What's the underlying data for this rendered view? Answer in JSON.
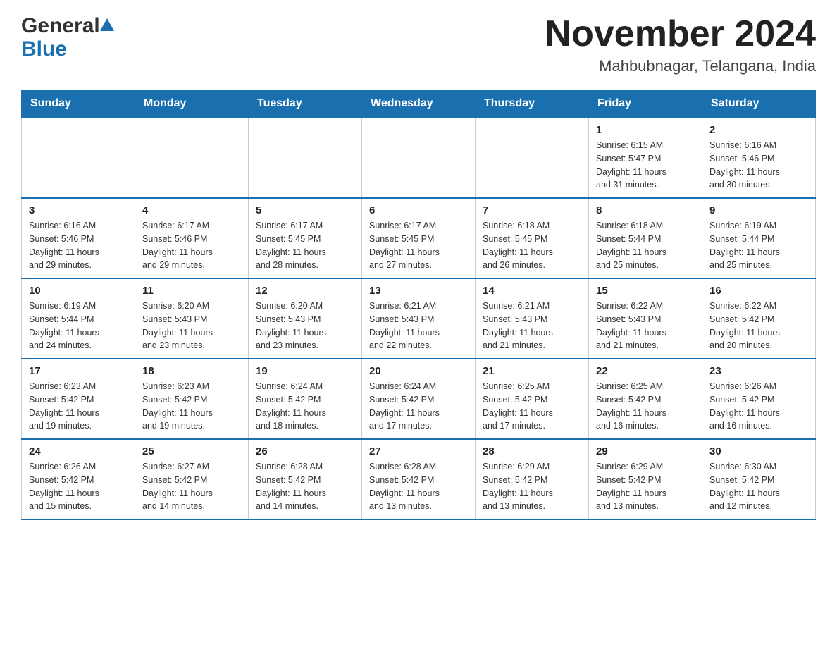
{
  "header": {
    "logo_general": "General",
    "logo_blue": "Blue",
    "month_title": "November 2024",
    "location": "Mahbubnagar, Telangana, India"
  },
  "weekdays": [
    "Sunday",
    "Monday",
    "Tuesday",
    "Wednesday",
    "Thursday",
    "Friday",
    "Saturday"
  ],
  "weeks": [
    [
      {
        "day": "",
        "info": ""
      },
      {
        "day": "",
        "info": ""
      },
      {
        "day": "",
        "info": ""
      },
      {
        "day": "",
        "info": ""
      },
      {
        "day": "",
        "info": ""
      },
      {
        "day": "1",
        "info": "Sunrise: 6:15 AM\nSunset: 5:47 PM\nDaylight: 11 hours\nand 31 minutes."
      },
      {
        "day": "2",
        "info": "Sunrise: 6:16 AM\nSunset: 5:46 PM\nDaylight: 11 hours\nand 30 minutes."
      }
    ],
    [
      {
        "day": "3",
        "info": "Sunrise: 6:16 AM\nSunset: 5:46 PM\nDaylight: 11 hours\nand 29 minutes."
      },
      {
        "day": "4",
        "info": "Sunrise: 6:17 AM\nSunset: 5:46 PM\nDaylight: 11 hours\nand 29 minutes."
      },
      {
        "day": "5",
        "info": "Sunrise: 6:17 AM\nSunset: 5:45 PM\nDaylight: 11 hours\nand 28 minutes."
      },
      {
        "day": "6",
        "info": "Sunrise: 6:17 AM\nSunset: 5:45 PM\nDaylight: 11 hours\nand 27 minutes."
      },
      {
        "day": "7",
        "info": "Sunrise: 6:18 AM\nSunset: 5:45 PM\nDaylight: 11 hours\nand 26 minutes."
      },
      {
        "day": "8",
        "info": "Sunrise: 6:18 AM\nSunset: 5:44 PM\nDaylight: 11 hours\nand 25 minutes."
      },
      {
        "day": "9",
        "info": "Sunrise: 6:19 AM\nSunset: 5:44 PM\nDaylight: 11 hours\nand 25 minutes."
      }
    ],
    [
      {
        "day": "10",
        "info": "Sunrise: 6:19 AM\nSunset: 5:44 PM\nDaylight: 11 hours\nand 24 minutes."
      },
      {
        "day": "11",
        "info": "Sunrise: 6:20 AM\nSunset: 5:43 PM\nDaylight: 11 hours\nand 23 minutes."
      },
      {
        "day": "12",
        "info": "Sunrise: 6:20 AM\nSunset: 5:43 PM\nDaylight: 11 hours\nand 23 minutes."
      },
      {
        "day": "13",
        "info": "Sunrise: 6:21 AM\nSunset: 5:43 PM\nDaylight: 11 hours\nand 22 minutes."
      },
      {
        "day": "14",
        "info": "Sunrise: 6:21 AM\nSunset: 5:43 PM\nDaylight: 11 hours\nand 21 minutes."
      },
      {
        "day": "15",
        "info": "Sunrise: 6:22 AM\nSunset: 5:43 PM\nDaylight: 11 hours\nand 21 minutes."
      },
      {
        "day": "16",
        "info": "Sunrise: 6:22 AM\nSunset: 5:42 PM\nDaylight: 11 hours\nand 20 minutes."
      }
    ],
    [
      {
        "day": "17",
        "info": "Sunrise: 6:23 AM\nSunset: 5:42 PM\nDaylight: 11 hours\nand 19 minutes."
      },
      {
        "day": "18",
        "info": "Sunrise: 6:23 AM\nSunset: 5:42 PM\nDaylight: 11 hours\nand 19 minutes."
      },
      {
        "day": "19",
        "info": "Sunrise: 6:24 AM\nSunset: 5:42 PM\nDaylight: 11 hours\nand 18 minutes."
      },
      {
        "day": "20",
        "info": "Sunrise: 6:24 AM\nSunset: 5:42 PM\nDaylight: 11 hours\nand 17 minutes."
      },
      {
        "day": "21",
        "info": "Sunrise: 6:25 AM\nSunset: 5:42 PM\nDaylight: 11 hours\nand 17 minutes."
      },
      {
        "day": "22",
        "info": "Sunrise: 6:25 AM\nSunset: 5:42 PM\nDaylight: 11 hours\nand 16 minutes."
      },
      {
        "day": "23",
        "info": "Sunrise: 6:26 AM\nSunset: 5:42 PM\nDaylight: 11 hours\nand 16 minutes."
      }
    ],
    [
      {
        "day": "24",
        "info": "Sunrise: 6:26 AM\nSunset: 5:42 PM\nDaylight: 11 hours\nand 15 minutes."
      },
      {
        "day": "25",
        "info": "Sunrise: 6:27 AM\nSunset: 5:42 PM\nDaylight: 11 hours\nand 14 minutes."
      },
      {
        "day": "26",
        "info": "Sunrise: 6:28 AM\nSunset: 5:42 PM\nDaylight: 11 hours\nand 14 minutes."
      },
      {
        "day": "27",
        "info": "Sunrise: 6:28 AM\nSunset: 5:42 PM\nDaylight: 11 hours\nand 13 minutes."
      },
      {
        "day": "28",
        "info": "Sunrise: 6:29 AM\nSunset: 5:42 PM\nDaylight: 11 hours\nand 13 minutes."
      },
      {
        "day": "29",
        "info": "Sunrise: 6:29 AM\nSunset: 5:42 PM\nDaylight: 11 hours\nand 13 minutes."
      },
      {
        "day": "30",
        "info": "Sunrise: 6:30 AM\nSunset: 5:42 PM\nDaylight: 11 hours\nand 12 minutes."
      }
    ]
  ]
}
